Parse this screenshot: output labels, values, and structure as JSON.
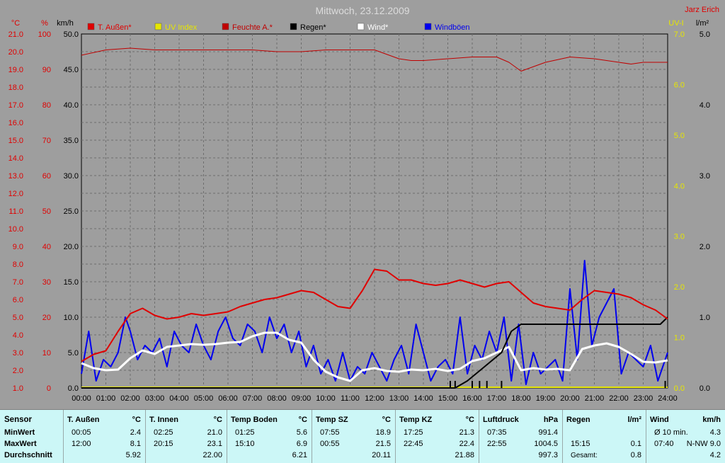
{
  "title": "Mittwoch, 23.12.2009",
  "author": "Jarz Erich",
  "colors": {
    "background": "#9e9e9e",
    "grid": "#6e6e6e",
    "temperature": "#e00000",
    "uv": "#e6e600",
    "humidity": "#c00000",
    "rain": "#000000",
    "wind": "#ffffff",
    "gusts": "#0000ee"
  },
  "axes": {
    "temp": {
      "unit": "°C",
      "min": 1.0,
      "max": 21.0,
      "step": 1.0,
      "labels": [
        "1.0",
        "2.0",
        "3.0",
        "4.0",
        "5.0",
        "6.0",
        "7.0",
        "8.0",
        "9.0",
        "10.0",
        "11.0",
        "12.0",
        "13.0",
        "14.0",
        "15.0",
        "16.0",
        "17.0",
        "18.0",
        "19.0",
        "20.0",
        "21.0"
      ]
    },
    "humidity": {
      "unit": "%",
      "labels": [
        "0",
        "10",
        "20",
        "30",
        "40",
        "50",
        "60",
        "70",
        "80",
        "90",
        "100"
      ]
    },
    "wind": {
      "unit": "km/h",
      "labels": [
        "0.0",
        "5.0",
        "10.0",
        "15.0",
        "20.0",
        "25.0",
        "30.0",
        "35.0",
        "40.0",
        "45.0",
        "50.0"
      ]
    },
    "uv": {
      "unit": "UV-I",
      "labels": [
        "0.0",
        "1.0",
        "2.0",
        "3.0",
        "4.0",
        "5.0",
        "6.0",
        "7.0"
      ]
    },
    "rain": {
      "unit": "l/m²",
      "labels": [
        "0.0",
        "1.0",
        "2.0",
        "3.0",
        "4.0",
        "5.0"
      ]
    },
    "x": {
      "labels": [
        "00:00",
        "01:00",
        "02:00",
        "03:00",
        "04:00",
        "05:00",
        "06:00",
        "07:00",
        "08:00",
        "09:00",
        "10:00",
        "11:00",
        "12:00",
        "13:00",
        "14:00",
        "15:00",
        "16:00",
        "17:00",
        "18:00",
        "19:00",
        "20:00",
        "21:00",
        "22:00",
        "23:00",
        "24:00"
      ]
    }
  },
  "legend": [
    {
      "label": "T. Außen*",
      "color": "#e00000"
    },
    {
      "label": "UV Index",
      "color": "#e6e600"
    },
    {
      "label": "Feuchte A.*",
      "color": "#c00000"
    },
    {
      "label": "Regen*",
      "color": "#000000"
    },
    {
      "label": "Wind*",
      "color": "#ffffff"
    },
    {
      "label": "Windböen",
      "color": "#0000ee"
    }
  ],
  "chart_data": {
    "type": "line",
    "title": "Mittwoch, 23.12.2009",
    "x_unit": "hours",
    "grid": true,
    "legend_position": "top",
    "series": [
      {
        "name": "T. Außen*",
        "axis": "temp",
        "color": "#e00000",
        "x": [
          0,
          0.5,
          1,
          1.5,
          2,
          2.5,
          3,
          3.5,
          4,
          4.5,
          5,
          5.5,
          6,
          6.5,
          7,
          7.5,
          8,
          8.5,
          9,
          9.5,
          10,
          10.5,
          11,
          11.5,
          12,
          12.5,
          13,
          13.5,
          14,
          14.5,
          15,
          15.5,
          16,
          16.5,
          17,
          17.5,
          18,
          18.5,
          19,
          19.5,
          20,
          20.5,
          21,
          21.5,
          22,
          22.5,
          23,
          23.5,
          24
        ],
        "y": [
          2.5,
          2.9,
          3.1,
          4.2,
          5.2,
          5.5,
          5.1,
          4.9,
          5.0,
          5.2,
          5.1,
          5.2,
          5.3,
          5.6,
          5.8,
          6.0,
          6.1,
          6.3,
          6.5,
          6.4,
          6.0,
          5.6,
          5.5,
          6.5,
          7.7,
          7.6,
          7.1,
          7.1,
          6.9,
          6.8,
          6.9,
          7.1,
          6.9,
          6.7,
          6.9,
          7.0,
          6.4,
          5.8,
          5.6,
          5.5,
          5.4,
          6.0,
          6.5,
          6.4,
          6.3,
          6.1,
          5.7,
          5.4,
          4.9
        ]
      },
      {
        "name": "Feuchte A.*",
        "axis": "humidity",
        "color": "#c00000",
        "x": [
          0,
          1,
          2,
          3,
          4,
          5,
          6,
          7,
          8,
          9,
          10,
          11,
          12,
          13,
          13.5,
          14,
          15,
          16,
          17,
          17.5,
          18,
          19,
          20,
          21,
          22,
          22.5,
          23,
          24
        ],
        "y": [
          94,
          95.5,
          96,
          95.5,
          95.5,
          95.5,
          95.5,
          95.5,
          95,
          95,
          95.5,
          95.5,
          95.5,
          93,
          92.5,
          92.5,
          93,
          93.5,
          93.5,
          92,
          89.5,
          92,
          93.5,
          93,
          92,
          91.5,
          92,
          92
        ]
      },
      {
        "name": "Regen*",
        "axis": "rain",
        "color": "#000000",
        "x": [
          0,
          15.3,
          15.8,
          16.5,
          17.2,
          17.6,
          18,
          18.5,
          19,
          20,
          21,
          22,
          23,
          23.7,
          24
        ],
        "y": [
          0,
          0,
          0.1,
          0.3,
          0.5,
          0.8,
          0.9,
          0.9,
          0.9,
          0.9,
          0.9,
          0.9,
          0.9,
          0.9,
          1.0
        ]
      },
      {
        "name": "Wind*",
        "axis": "wind",
        "color": "#ffffff",
        "x": [
          0,
          0.5,
          1,
          1.5,
          2,
          2.5,
          3,
          3.5,
          4,
          4.5,
          5,
          5.5,
          6,
          6.5,
          7,
          7.5,
          8,
          8.5,
          9,
          9.5,
          10,
          10.5,
          11,
          11.5,
          12,
          12.5,
          13,
          13.5,
          14,
          14.5,
          15,
          15.5,
          16,
          16.5,
          17,
          17.5,
          18,
          18.5,
          19,
          19.5,
          20,
          20.5,
          21,
          21.5,
          22,
          22.5,
          23,
          23.5,
          24
        ],
        "y": [
          3.5,
          2.8,
          2.5,
          2.6,
          4.2,
          5.3,
          4.8,
          5.8,
          6.0,
          6.2,
          6.1,
          6.2,
          6.4,
          6.5,
          7.3,
          7.8,
          7.8,
          6.8,
          6.4,
          4.0,
          2.3,
          1.5,
          1.0,
          2.5,
          2.8,
          2.4,
          2.3,
          2.6,
          2.5,
          2.7,
          2.4,
          2.7,
          3.8,
          4.2,
          5.0,
          5.8,
          2.5,
          2.8,
          2.6,
          2.7,
          2.5,
          5.5,
          6.0,
          6.3,
          5.8,
          4.8,
          3.7,
          3.6,
          3.9
        ]
      },
      {
        "name": "Windböen",
        "axis": "wind",
        "color": "#0000ee",
        "x": [
          0,
          0.3,
          0.6,
          0.9,
          1.2,
          1.5,
          1.8,
          2.0,
          2.3,
          2.6,
          2.9,
          3.2,
          3.5,
          3.8,
          4.1,
          4.4,
          4.7,
          5.0,
          5.3,
          5.6,
          5.9,
          6.2,
          6.5,
          6.8,
          7.1,
          7.4,
          7.7,
          8.0,
          8.3,
          8.6,
          8.9,
          9.2,
          9.5,
          9.8,
          10.1,
          10.4,
          10.7,
          11.0,
          11.3,
          11.6,
          11.9,
          12.2,
          12.5,
          12.8,
          13.1,
          13.4,
          13.7,
          14.0,
          14.3,
          14.6,
          14.9,
          15.2,
          15.5,
          15.8,
          16.1,
          16.4,
          16.7,
          17.0,
          17.3,
          17.6,
          17.9,
          18.2,
          18.5,
          18.8,
          19.1,
          19.4,
          19.7,
          20.0,
          20.3,
          20.6,
          20.9,
          21.2,
          21.5,
          21.8,
          22.1,
          22.4,
          22.7,
          23.0,
          23.3,
          23.6,
          24.0
        ],
        "y": [
          2,
          8,
          1,
          4,
          3,
          5,
          10,
          8,
          4,
          6,
          5,
          7,
          3,
          8,
          6,
          5,
          9,
          6,
          4,
          8,
          10,
          7,
          6,
          9,
          8,
          5,
          10,
          7,
          9,
          5,
          8,
          3,
          6,
          2,
          4,
          1,
          5,
          1,
          3,
          2,
          5,
          3,
          1,
          4,
          6,
          2,
          9,
          5,
          1,
          3,
          4,
          2,
          10,
          2,
          6,
          4,
          8,
          5,
          10,
          1,
          9,
          0.5,
          5,
          2,
          3,
          4,
          1,
          14,
          4,
          18,
          6,
          10,
          12,
          14,
          2,
          5,
          4,
          3,
          6,
          1,
          5
        ]
      }
    ],
    "uv_index": [
      {
        "x": 0,
        "y": 0
      },
      {
        "x": 24,
        "y": 0
      }
    ],
    "rain_ticks_hours": [
      15.1,
      15.3,
      16.0,
      16.3,
      16.6,
      17.2,
      23.9
    ]
  },
  "stats": {
    "row_labels": [
      "Sensor",
      "MinWert",
      "MaxWert",
      "Durchschnitt"
    ],
    "columns": [
      {
        "name": "T. Außen",
        "unit": "°C",
        "min_time": "00:05",
        "min_val": "2.4",
        "max_time": "12:00",
        "max_val": "8.1",
        "avg": "5.92"
      },
      {
        "name": "T. Innen",
        "unit": "°C",
        "min_time": "02:25",
        "min_val": "21.0",
        "max_time": "20:15",
        "max_val": "23.1",
        "avg": "22.00"
      },
      {
        "name": "Temp Boden",
        "unit": "°C",
        "min_time": "01:25",
        "min_val": "5.6",
        "max_time": "15:10",
        "max_val": "6.9",
        "avg": "6.21"
      },
      {
        "name": "Temp SZ",
        "unit": "°C",
        "min_time": "07:55",
        "min_val": "18.9",
        "max_time": "00:55",
        "max_val": "21.5",
        "avg": "20.11"
      },
      {
        "name": "Temp KZ",
        "unit": "°C",
        "min_time": "17:25",
        "min_val": "21.3",
        "max_time": "22:45",
        "max_val": "22.4",
        "avg": "21.88"
      },
      {
        "name": "Luftdruck",
        "unit": "hPa",
        "min_time": "07:35",
        "min_val": "991.4",
        "max_time": "22:55",
        "max_val": "1004.5",
        "avg": "997.3"
      },
      {
        "name": "Regen",
        "unit": "l/m²",
        "min_time": "",
        "min_val": "",
        "max_time": "15:15",
        "max_val": "0.1",
        "avg_label": "Gesamt:",
        "avg": "0.8"
      },
      {
        "name": "Wind",
        "unit": "km/h",
        "min_time": "Ø 10 min.",
        "min_val": "4.3",
        "max_time": "07:40",
        "max_val": "N-NW 9.0",
        "avg": "4.2"
      }
    ]
  }
}
